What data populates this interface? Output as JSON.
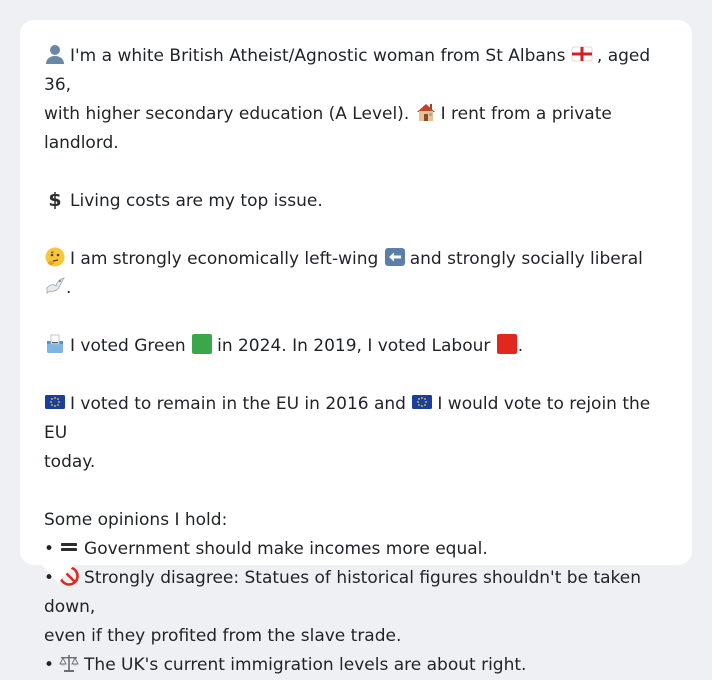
{
  "persona": {
    "line1_text_a": "I'm a white British Atheist/Agnostic woman from St Albans",
    "line1_text_b": ", aged 36,",
    "line2_text_a": "with higher secondary education (A Level).",
    "line2_text_b": "I rent from a private landlord.",
    "issue_text": "Living costs are my top issue.",
    "politics_text_a": "I am strongly economically left-wing",
    "politics_text_b": "and strongly socially liberal",
    "politics_text_c": ".",
    "vote_text_a": "I voted Green",
    "vote_text_b": "in 2024. In 2019, I voted Labour",
    "vote_text_c": ".",
    "eu_text_a": "I voted to remain in the EU in 2016 and",
    "eu_text_b": "I would vote to rejoin the EU",
    "eu_text_c": "today.",
    "opinions_heading": "Some opinions I hold:",
    "bullet_char": "•",
    "opinion1": "Government should make incomes more equal.",
    "opinion2_a": "Strongly disagree: Statues of historical figures shouldn't be taken down,",
    "opinion2_b": "even if they profited from the slave trade.",
    "opinion3": "The UK's current immigration levels are about right."
  },
  "icons": {
    "person": "person-silhouette-icon",
    "england_flag": "england-flag-icon",
    "house": "house-icon",
    "dollar": "dollar-sign-icon",
    "thinking": "thinking-face-icon",
    "left_arrow": "left-arrow-icon",
    "dove": "dove-icon",
    "ballot": "ballot-box-icon",
    "green_square": "green-square-icon",
    "red_square": "red-square-icon",
    "eu_flag": "eu-flag-icon",
    "equals": "equals-sign-icon",
    "prohibited": "prohibited-icon",
    "scales": "balance-scale-icon"
  },
  "colors": {
    "green_party": "#3aa84a",
    "labour": "#e0281f",
    "eu_blue": "#1a3f9c",
    "text": "#1f2328"
  }
}
